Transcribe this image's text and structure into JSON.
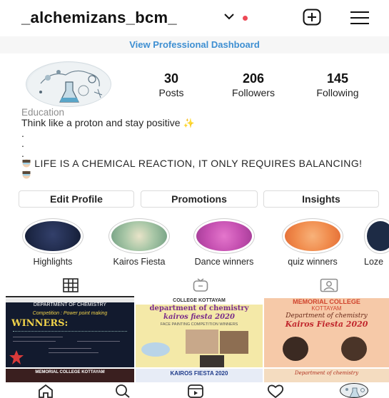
{
  "header": {
    "username": "_alchemizans_bcm_"
  },
  "dashboard_link": "View Professional Dashboard",
  "stats": [
    {
      "value": "30",
      "label": "Posts"
    },
    {
      "value": "206",
      "label": "Followers"
    },
    {
      "value": "145",
      "label": "Following"
    }
  ],
  "profile": {
    "category": "Education",
    "bio_line1": "Think like a proton and stay positive",
    "bio_dots": ".\n.\n.",
    "bio_line2": "LIFE IS A CHEMICAL REACTION, IT ONLY REQUIRES BALANCING!"
  },
  "buttons": {
    "edit_profile": "Edit Profile",
    "promotions": "Promotions",
    "insights": "Insights"
  },
  "highlights": [
    {
      "label": "Highlights",
      "color": "#1f2a4a"
    },
    {
      "label": "Kairos Fiesta",
      "color": "#8fb89a"
    },
    {
      "label": "Dance winners",
      "color": "#c44fb0"
    },
    {
      "label": "quiz winners",
      "color": "#f08a4b"
    },
    {
      "label": "Loze",
      "color": "#1d2b45"
    }
  ],
  "posts": [
    {
      "college": "",
      "line1": "DEPARTMENT OF CHEMISTRY",
      "line2": "Competition : Power point making",
      "line3": "WINNERS:",
      "bg": "#121a2e"
    },
    {
      "college": "COLLEGE KOTTAYAM",
      "line1": "department of chemistry",
      "line2": "kairos fiesta 2020",
      "line3": "FACE PAINTING COMPETITION WINNERS",
      "bg": "#f4e9a8"
    },
    {
      "college": "MEMORIAL COLLEGE",
      "line1": "KOTTAYAM",
      "line2": "Department of chemistry",
      "line3": "Kairos Fiesta 2020",
      "bg": "#f6c9a8"
    }
  ],
  "posts_row2": [
    {
      "text": "MEMORIAL COLLEGE KOTTAYAM",
      "bg": "#3a1f1f"
    },
    {
      "text": "KAIROS FIESTA 2020",
      "bg": "#e7ecf6"
    },
    {
      "text": "Department of chemistry",
      "bg": "#f4dcc0"
    }
  ],
  "colors": {
    "accent_link": "#3e8fd2",
    "notification_dot": "#ed4956"
  }
}
